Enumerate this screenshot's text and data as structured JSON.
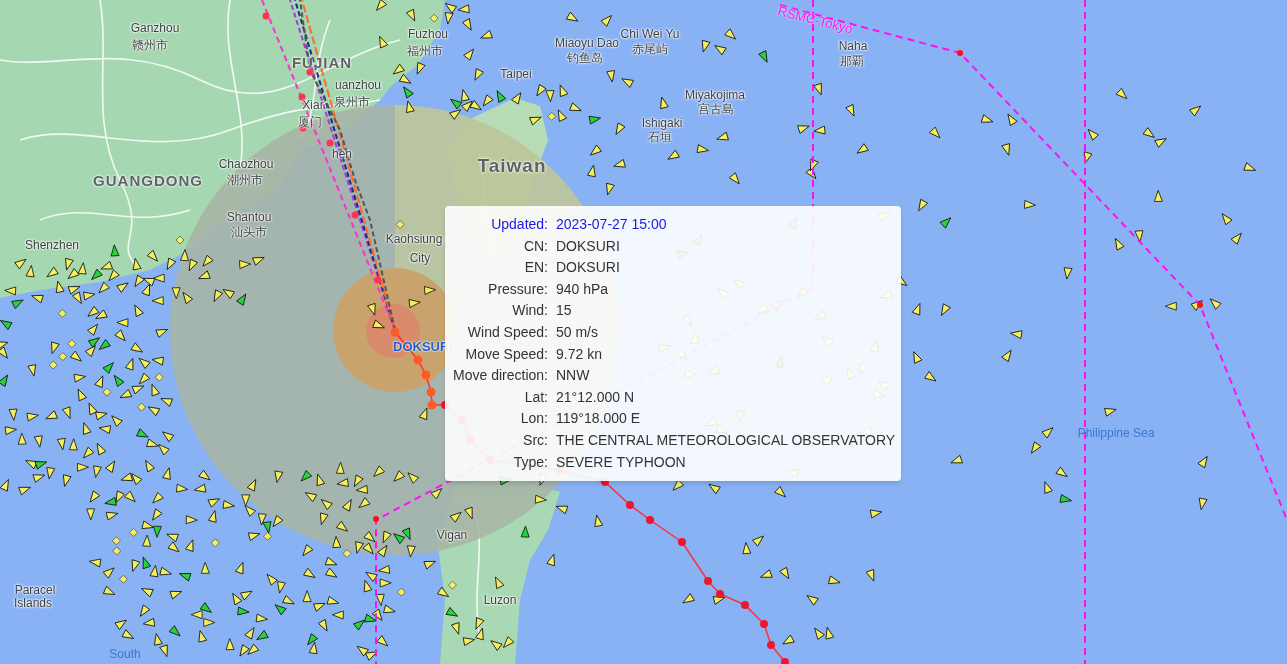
{
  "map": {
    "places": [
      {
        "text": "Ganzhou",
        "kind": "city"
      },
      {
        "text": "赣州市",
        "kind": "city"
      },
      {
        "text": "Fuzhou",
        "kind": "city"
      },
      {
        "text": "福州市",
        "kind": "city"
      },
      {
        "text": "FUJIAN",
        "kind": "province"
      },
      {
        "text": "uanzhou",
        "kind": "city"
      },
      {
        "text": "Xiar",
        "kind": "city"
      },
      {
        "text": "泉州市",
        "kind": "city"
      },
      {
        "text": "厦门",
        "kind": "city"
      },
      {
        "text": "hen",
        "kind": "city"
      },
      {
        "text": "GUANGDONG",
        "kind": "province"
      },
      {
        "text": "Chaozhou",
        "kind": "city"
      },
      {
        "text": "潮州市",
        "kind": "city"
      },
      {
        "text": "Shantou",
        "kind": "city"
      },
      {
        "text": "汕头市",
        "kind": "city"
      },
      {
        "text": "Shenzhen",
        "kind": "city"
      },
      {
        "text": "Taipei",
        "kind": "city"
      },
      {
        "text": "Taiwan",
        "kind": "country"
      },
      {
        "text": "Kaohsiung",
        "kind": "city"
      },
      {
        "text": "City",
        "kind": "city"
      },
      {
        "text": "Miaoyu Dao",
        "kind": "city"
      },
      {
        "text": "钓鱼岛",
        "kind": "city"
      },
      {
        "text": "Chi Wei Yu",
        "kind": "city"
      },
      {
        "text": "赤尾屿",
        "kind": "city"
      },
      {
        "text": "Miyakojima",
        "kind": "city"
      },
      {
        "text": "宫古島",
        "kind": "city"
      },
      {
        "text": "Ishigaki",
        "kind": "city"
      },
      {
        "text": "石垣",
        "kind": "city"
      },
      {
        "text": "Naha",
        "kind": "city"
      },
      {
        "text": "那覇",
        "kind": "city"
      },
      {
        "text": "Vigan",
        "kind": "city"
      },
      {
        "text": "Luzon",
        "kind": "city"
      },
      {
        "text": "Paracel",
        "kind": "city"
      },
      {
        "text": "Islands",
        "kind": "city"
      },
      {
        "text": "South",
        "kind": "water"
      },
      {
        "text": "Philippine Sea",
        "kind": "water"
      }
    ],
    "track_label": "RSMC-Tokyo",
    "typhoon_label": "DOKSURI"
  },
  "popup": {
    "rows": [
      {
        "label": "Updated:",
        "value": "2023-07-27 15:00",
        "highlighted": true
      },
      {
        "label": "CN:",
        "value": "DOKSURI",
        "highlighted": false
      },
      {
        "label": "EN:",
        "value": "DOKSURI",
        "highlighted": false
      },
      {
        "label": "Pressure:",
        "value": "940 hPa",
        "highlighted": false
      },
      {
        "label": "Wind:",
        "value": "15",
        "highlighted": false
      },
      {
        "label": "Wind Speed:",
        "value": "50 m/s",
        "highlighted": false
      },
      {
        "label": "Move Speed:",
        "value": "9.72 kn",
        "highlighted": false
      },
      {
        "label": "Move direction:",
        "value": "NNW",
        "highlighted": false
      },
      {
        "label": "Lat:",
        "value": "21°12.000 N",
        "highlighted": false
      },
      {
        "label": "Lon:",
        "value": "119°18.000 E",
        "highlighted": false
      },
      {
        "label": "Src:",
        "value": "THE CENTRAL METEOROLOGICAL OBSERVATORY",
        "highlighted": false
      },
      {
        "label": "Type:",
        "value": "SEVERE TYPHOON",
        "highlighted": false
      }
    ]
  }
}
